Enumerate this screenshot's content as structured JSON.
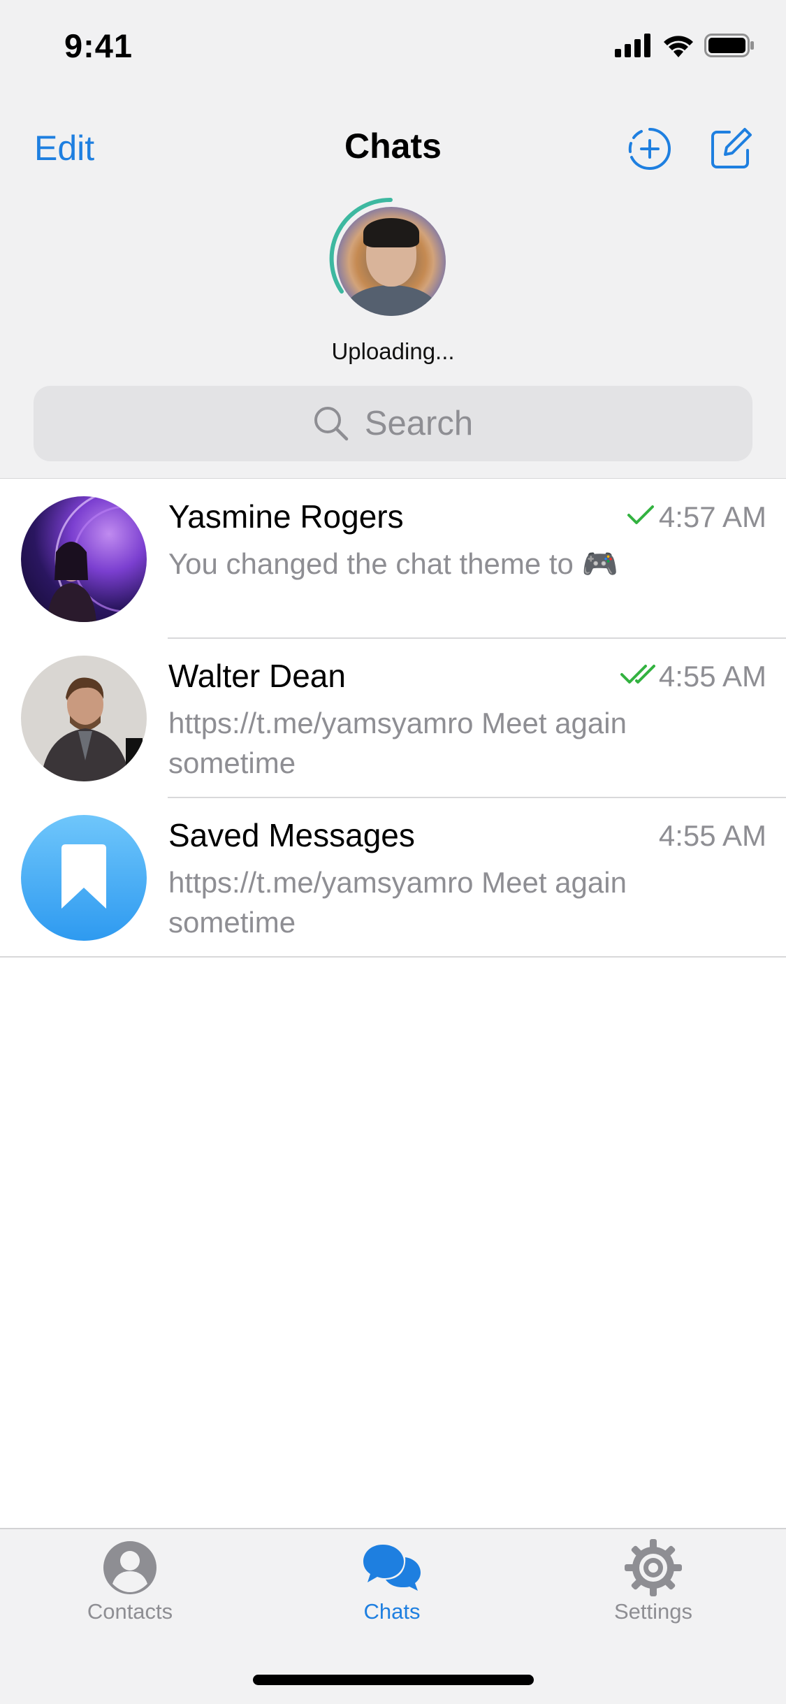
{
  "status_bar": {
    "time": "9:41",
    "icons": [
      "cellular-signal-icon",
      "wifi-icon",
      "battery-icon"
    ]
  },
  "nav": {
    "edit_label": "Edit",
    "title": "Chats",
    "story_add_icon": "story-add-icon",
    "compose_icon": "compose-icon"
  },
  "story": {
    "upload_label": "Uploading..."
  },
  "search": {
    "placeholder": "Search"
  },
  "chats": [
    {
      "name": "Yasmine Rogers",
      "time": "4:57 AM",
      "status": "sent-single-check",
      "preview": "You changed the chat theme to 🎮"
    },
    {
      "name": "Walter Dean",
      "time": "4:55 AM",
      "status": "read-double-check",
      "preview": "https://t.me/yamsyamro Meet again sometime"
    },
    {
      "name": "Saved Messages",
      "time": "4:55 AM",
      "status": "",
      "preview": "https://t.me/yamsyamro Meet again sometime"
    }
  ],
  "tabs": [
    {
      "label": "Contacts",
      "icon": "contacts-icon",
      "active": false
    },
    {
      "label": "Chats",
      "icon": "chats-icon",
      "active": true
    },
    {
      "label": "Settings",
      "icon": "settings-icon",
      "active": false
    }
  ],
  "colors": {
    "accent": "#1e7fe0",
    "check_green": "#33b240",
    "secondary_text": "#8e8e93",
    "header_bg": "#f1f1f2"
  }
}
